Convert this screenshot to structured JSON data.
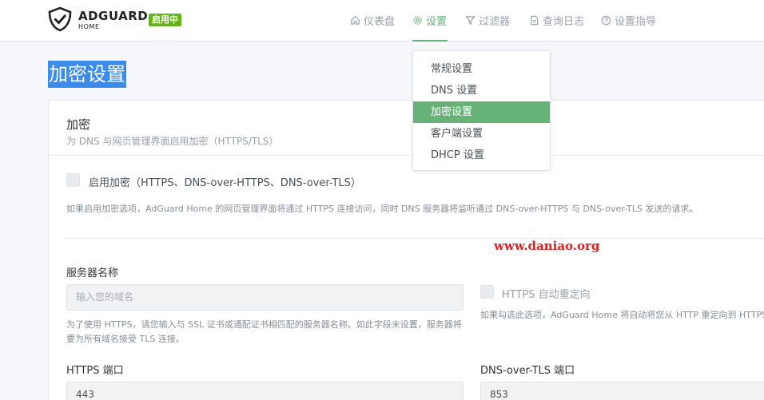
{
  "header": {
    "brand": "ADGUARD",
    "brand_sub": "HOME",
    "status_badge": "启用中",
    "nav": [
      {
        "label": "仪表盘",
        "icon": "home-icon"
      },
      {
        "label": "设置",
        "icon": "gear-icon",
        "active": true
      },
      {
        "label": "过滤器",
        "icon": "filter-icon"
      },
      {
        "label": "查询日志",
        "icon": "document-icon"
      },
      {
        "label": "设置指导",
        "icon": "help-circle-icon"
      }
    ]
  },
  "settings_menu": {
    "items": [
      {
        "label": "常规设置"
      },
      {
        "label": "DNS 设置"
      },
      {
        "label": "加密设置",
        "active": true
      },
      {
        "label": "客户端设置"
      },
      {
        "label": "DHCP 设置"
      }
    ]
  },
  "page": {
    "title": "加密设置"
  },
  "card": {
    "title": "加密",
    "subtitle": "为 DNS 与网页管理界面启用加密（HTTPS/TLS）",
    "enable_label": "启用加密（HTTPS、DNS-over-HTTPS、DNS-over-TLS）",
    "enable_note": "如果启用加密选项，AdGuard Home 的网页管理界面将通过 HTTPS 连接访问，同时 DNS 服务器将监听通过 DNS-over-HTTPS 与 DNS-over-TLS 发送的请求。",
    "server_name_label": "服务器名称",
    "server_name_placeholder": "输入您的域名",
    "server_name_note": "为了使用 HTTPS，请您输入与 SSL 证书或通配证书相匹配的服务器名称。如此字段未设置，服务器将要为所有域名接受 TLS 连接。",
    "redirect_label": "HTTPS 自动重定向",
    "redirect_note": "如果勾选此选项，AdGuard Home 将自动将您从 HTTP 重定向到 HTTPS",
    "https_port_label": "HTTPS 端口",
    "https_port_value": "443",
    "dot_port_label": "DNS-over-TLS 端口",
    "dot_port_value": "853"
  },
  "watermark": "www.daniao.org",
  "colors": {
    "accent": "#67b279",
    "badge": "#67b31d",
    "selection": "#3b8bea",
    "watermark": "#e02020"
  }
}
